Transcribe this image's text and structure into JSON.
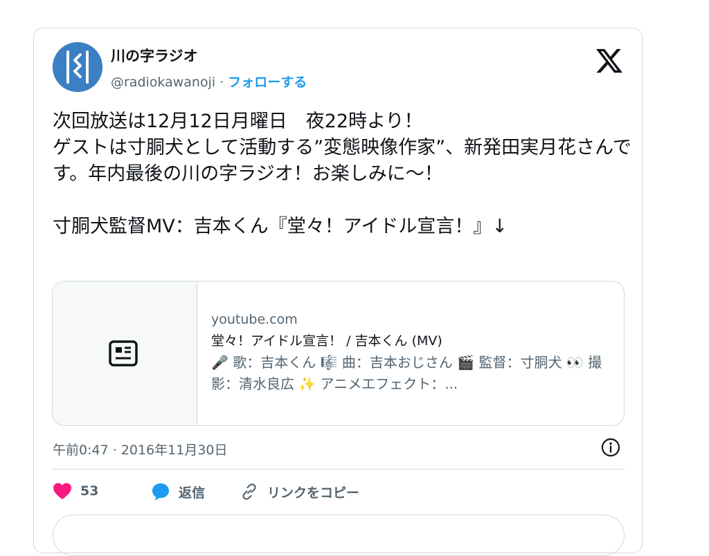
{
  "author": {
    "name": "川の字ラジオ",
    "handle": "@radiokawanoji",
    "separator": "·",
    "follow_label": "フォローする"
  },
  "tweet": {
    "text": "次回放送は12月12日月曜日　夜22時より！\nゲストは寸胴犬として活動する”変態映像作家”、新発田実月花さんです。年内最後の川の字ラジオ！お楽しみに〜！\n\n寸胴犬監督MV：吉本くん『堂々！アイドル宣言！』↓"
  },
  "link_card": {
    "domain": "youtube.com",
    "title": "堂々！アイドル宣言！ / 吉本くん (MV)",
    "description": "🎤 歌：吉本くん 🎼 曲：吉本おじさん 🎬 監督：寸胴犬 👀 撮影：清水良広 ✨ アニメエフェクト：...",
    "thumb_icon": "article-icon"
  },
  "meta": {
    "timestamp": "午前0:47 · 2016年11月30日",
    "info_icon": "info-icon"
  },
  "actions": {
    "like_count": "53",
    "reply_label": "返信",
    "copy_label": "リンクをコピー"
  },
  "colors": {
    "accent": "#1d9bf0",
    "like": "#f91880",
    "text": "#0f1419",
    "muted": "#536471",
    "border": "#cfd9de"
  }
}
